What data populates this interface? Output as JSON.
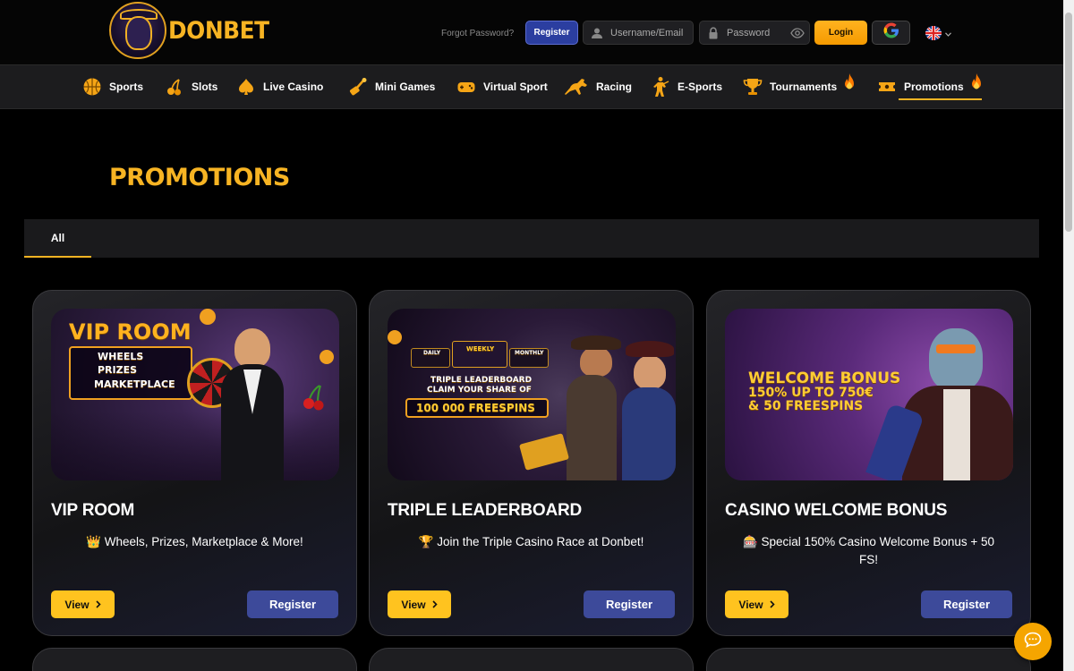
{
  "brand": {
    "name": "DONBET",
    "accent": "#f7b423"
  },
  "header": {
    "forgot_password": "Forgot Password?",
    "register_label": "Register",
    "username_placeholder": "Username/Email",
    "password_placeholder": "Password",
    "login_label": "Login",
    "google_icon": "google-icon",
    "language_icon": "uk-flag-icon"
  },
  "nav": {
    "items": [
      {
        "label": "Sports",
        "icon": "basketball-icon"
      },
      {
        "label": "Slots",
        "icon": "cherry-icon"
      },
      {
        "label": "Live Casino",
        "icon": "spade-icon"
      },
      {
        "label": "Mini Games",
        "icon": "joystick-icon"
      },
      {
        "label": "Virtual Sport",
        "icon": "gamepad-icon"
      },
      {
        "label": "Racing",
        "icon": "horse-icon"
      },
      {
        "label": "E-Sports",
        "icon": "soldier-icon"
      },
      {
        "label": "Tournaments",
        "icon": "trophy-icon"
      },
      {
        "label": "Promotions",
        "icon": "ticket-icon",
        "active": true
      }
    ]
  },
  "main": {
    "title": "PROMOTIONS",
    "tabs": [
      {
        "label": "All",
        "active": true
      }
    ]
  },
  "promotions": [
    {
      "title": "VIP ROOM",
      "description": "👑 Wheels, Prizes, Marketplace & More!",
      "banner": {
        "headline": "VIP ROOM",
        "lines": [
          "WHEELS",
          "PRIZES",
          "MARKETPLACE"
        ]
      },
      "view_label": "View",
      "register_label": "Register"
    },
    {
      "title": "TRIPLE LEADERBOARD",
      "description": "🏆 Join the Triple Casino Race at Donbet!",
      "banner": {
        "tabs": [
          "DAILY",
          "WEEKLY",
          "MONTHLY"
        ],
        "lines": [
          "TRIPLE LEADERBOARD",
          "CLAIM YOUR SHARE OF"
        ],
        "highlight": "100 000 FREESPINS"
      },
      "view_label": "View",
      "register_label": "Register"
    },
    {
      "title": "CASINO WELCOME BONUS",
      "description": "🎰 Special 150% Casino Welcome Bonus + 50 FS!",
      "banner": {
        "lines": [
          "WELCOME BONUS",
          "150% UP TO 750€",
          "& 50 FREESPINS"
        ]
      },
      "view_label": "View",
      "register_label": "Register"
    }
  ]
}
